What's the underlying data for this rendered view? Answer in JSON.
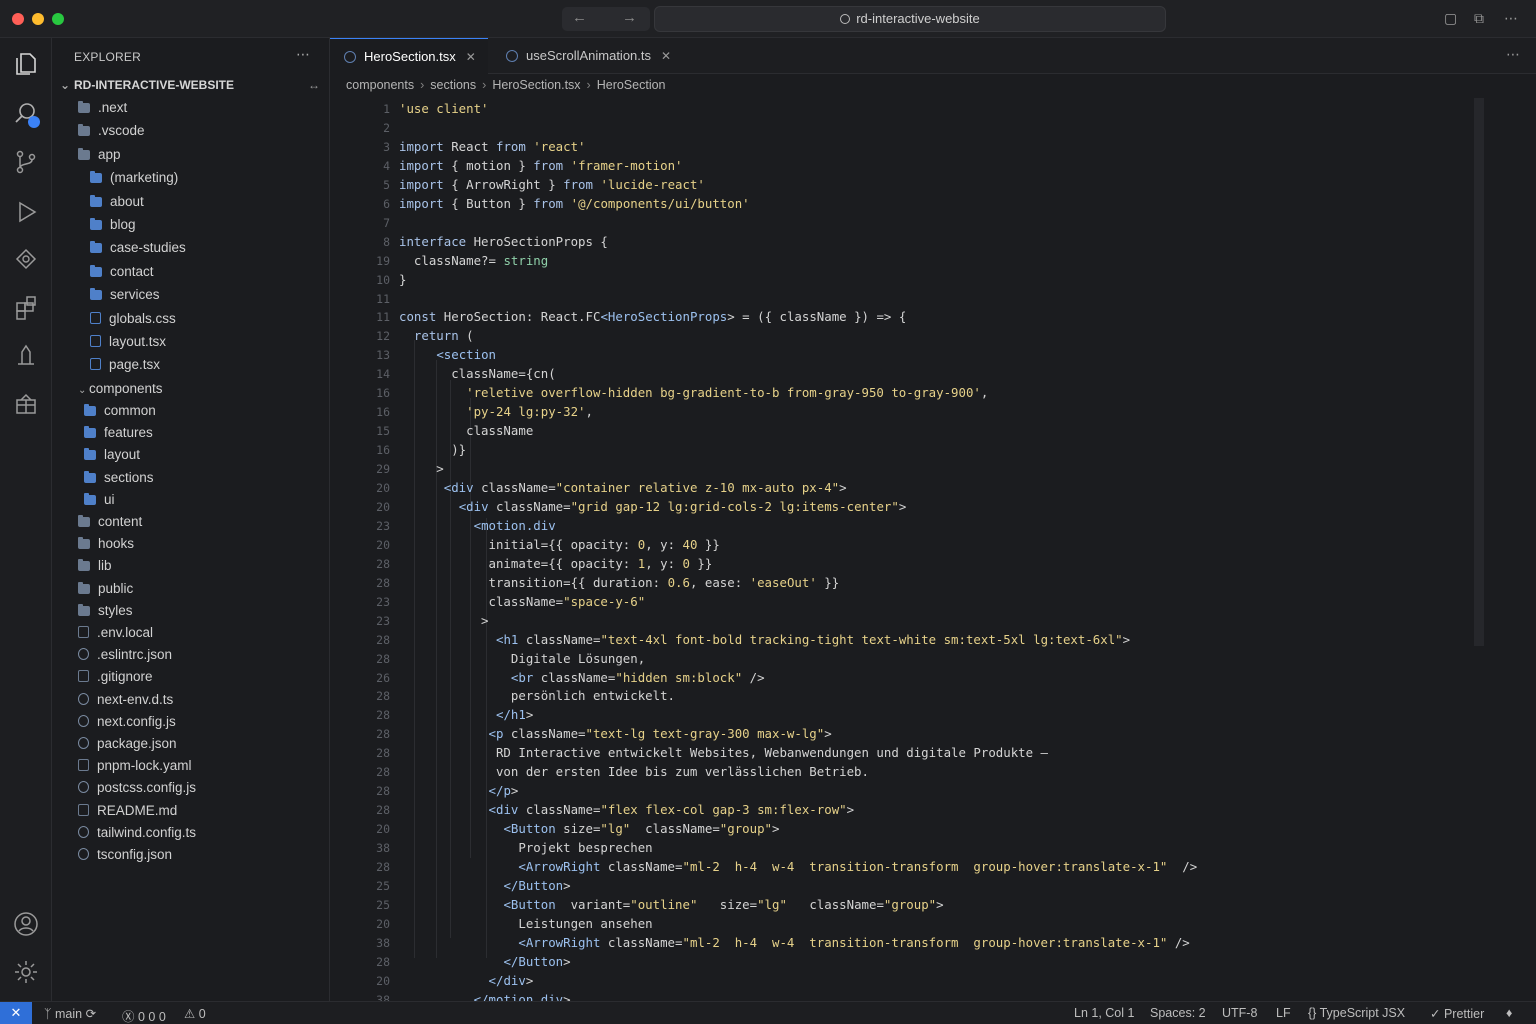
{
  "window": {
    "search_text": "rd-interactive-website"
  },
  "sidebar": {
    "title": "EXPLORER",
    "root": "RD-INTERACTIVE-WEBSITE",
    "items": [
      {
        "label": ".next",
        "type": "folder",
        "depth": 0
      },
      {
        "label": ".vscode",
        "type": "folder",
        "depth": 0
      },
      {
        "label": "app",
        "type": "folder",
        "depth": 0
      },
      {
        "label": "(marketing)",
        "type": "folder",
        "depth": 1
      },
      {
        "label": "about",
        "type": "folder",
        "depth": 1
      },
      {
        "label": "blog",
        "type": "folder",
        "depth": 1
      },
      {
        "label": "case-studies",
        "type": "folder",
        "depth": 1
      },
      {
        "label": "contact",
        "type": "folder",
        "depth": 1
      },
      {
        "label": "services",
        "type": "folder",
        "depth": 1
      },
      {
        "label": "globals.css",
        "type": "file",
        "depth": 1
      },
      {
        "label": "layout.tsx",
        "type": "file",
        "depth": 1
      },
      {
        "label": "page.tsx",
        "type": "file",
        "depth": 1
      },
      {
        "label": "components",
        "type": "folder-open",
        "depth": 0
      },
      {
        "label": "common",
        "type": "folder",
        "depth": 1
      },
      {
        "label": "features",
        "type": "folder",
        "depth": 1
      },
      {
        "label": "layout",
        "type": "folder",
        "depth": 1
      },
      {
        "label": "sections",
        "type": "folder",
        "depth": 1
      },
      {
        "label": "ui",
        "type": "folder",
        "depth": 1
      },
      {
        "label": "content",
        "type": "folder",
        "depth": 0
      },
      {
        "label": "hooks",
        "type": "folder",
        "depth": 0
      },
      {
        "label": "lib",
        "type": "folder",
        "depth": 0
      },
      {
        "label": "public",
        "type": "folder",
        "depth": 0
      },
      {
        "label": "styles",
        "type": "folder",
        "depth": 0
      },
      {
        "label": ".env.local",
        "type": "file",
        "depth": 0
      },
      {
        "label": ".eslintrc.json",
        "type": "file",
        "depth": 0
      },
      {
        "label": ".gitignore",
        "type": "file",
        "depth": 0
      },
      {
        "label": "next-env.d.ts",
        "type": "file",
        "depth": 0
      },
      {
        "label": "next.config.js",
        "type": "file",
        "depth": 0
      },
      {
        "label": "package.json",
        "type": "file",
        "depth": 0
      },
      {
        "label": "pnpm-lock.yaml",
        "type": "file",
        "depth": 0
      },
      {
        "label": "postcss.config.js",
        "type": "file",
        "depth": 0
      },
      {
        "label": "README.md",
        "type": "file",
        "depth": 0
      },
      {
        "label": "tailwind.config.ts",
        "type": "file",
        "depth": 0
      },
      {
        "label": "tsconfig.json",
        "type": "file",
        "depth": 0
      }
    ]
  },
  "tabs": [
    {
      "label": "HeroSection.tsx",
      "active": true
    },
    {
      "label": "useScrollAnimation.ts",
      "active": false
    }
  ],
  "breadcrumb": [
    "components",
    "sections",
    "HeroSection.tsx",
    "HeroSection"
  ],
  "editor": {
    "lines": [
      {
        "n": "1",
        "text": "'use client'"
      },
      {
        "n": "2",
        "text": ""
      },
      {
        "n": "3",
        "text": "import React from 'react'"
      },
      {
        "n": "4",
        "text": "import { motion } from 'framer-motion'"
      },
      {
        "n": "5",
        "text": "import { ArrowRight } from 'lucide-react'"
      },
      {
        "n": "6",
        "text": "import { Button } from '@/components/ui/button'"
      },
      {
        "n": "7",
        "text": ""
      },
      {
        "n": "8",
        "text": "interface HeroSectionProps {"
      },
      {
        "n": "19",
        "text": "  className?= string"
      },
      {
        "n": "10",
        "text": "}"
      },
      {
        "n": "11",
        "text": ""
      },
      {
        "n": "11",
        "text": "const HeroSection: React.FC<HeroSectionProps> = ({ className }) => {"
      },
      {
        "n": "12",
        "text": "  return ("
      },
      {
        "n": "13",
        "text": "     <section"
      },
      {
        "n": "14",
        "text": "       className={cn("
      },
      {
        "n": "16",
        "text": "         'reletive overflow-hidden bg-gradient-to-b from-gray-950 to-gray-900',"
      },
      {
        "n": "16",
        "text": "         'py-24 lg:py-32',"
      },
      {
        "n": "15",
        "text": "         className"
      },
      {
        "n": "16",
        "text": "       )}"
      },
      {
        "n": "29",
        "text": "     >"
      },
      {
        "n": "20",
        "text": "      <div className=\"container relative z-10 mx-auto px-4\">"
      },
      {
        "n": "20",
        "text": "        <div className=\"grid gap-12 lg:grid-cols-2 lg:items-center\">"
      },
      {
        "n": "23",
        "text": "          <motion.div"
      },
      {
        "n": "20",
        "text": "            initial={{ opacity: 0, y: 40 }}"
      },
      {
        "n": "28",
        "text": "            animate={{ opacity: 1, y: 0 }}"
      },
      {
        "n": "28",
        "text": "            transition={{ duration: 0.6, ease: 'easeOut' }}"
      },
      {
        "n": "23",
        "text": "            className=\"space-y-6\""
      },
      {
        "n": "23",
        "text": "           >"
      },
      {
        "n": "28",
        "text": "             <h1 className=\"text-4xl font-bold tracking-tight text-white sm:text-5xl lg:text-6xl\">"
      },
      {
        "n": "28",
        "text": "               Digitale Lösungen,"
      },
      {
        "n": "26",
        "text": "               <br className=\"hidden sm:block\" />"
      },
      {
        "n": "28",
        "text": "               persönlich entwickelt."
      },
      {
        "n": "28",
        "text": "             </h1>"
      },
      {
        "n": "28",
        "text": "            <p className=\"text-lg text-gray-300 max-w-lg\">"
      },
      {
        "n": "28",
        "text": "             RD Interactive entwickelt Websites, Webanwendungen und digitale Produkte –"
      },
      {
        "n": "28",
        "text": "             von der ersten Idee bis zum verlässlichen Betrieb."
      },
      {
        "n": "28",
        "text": "            </p>"
      },
      {
        "n": "28",
        "text": "            <div className=\"flex flex-col gap-3 sm:flex-row\">"
      },
      {
        "n": "20",
        "text": "              <Button size=\"lg\"  className=\"group\">"
      },
      {
        "n": "38",
        "text": "                Projekt besprechen"
      },
      {
        "n": "28",
        "text": "                <ArrowRight className=\"ml-2  h-4  w-4  transition-transform  group-hover:translate-x-1\"  />"
      },
      {
        "n": "25",
        "text": "              </Button>"
      },
      {
        "n": "25",
        "text": "              <Button  variant=\"outline\"   size=\"lg\"   className=\"group\">"
      },
      {
        "n": "20",
        "text": "                Leistungen ansehen"
      },
      {
        "n": "38",
        "text": "                <ArrowRight className=\"ml-2  h-4  w-4  transition-transform  group-hover:translate-x-1\" />"
      },
      {
        "n": "28",
        "text": "              </Button>"
      },
      {
        "n": "20",
        "text": "            </div>"
      },
      {
        "n": "38",
        "text": "          </motion.div>"
      }
    ]
  },
  "statusbar": {
    "branch": "main",
    "problems": "0 0 0",
    "warnings": "0",
    "position": "Ln 1, Col 1",
    "spaces": "Spaces: 2",
    "encoding": "UTF-8",
    "eol": "LF",
    "language": "TypeScript JSX",
    "formatter": "Prettier"
  },
  "colors": {
    "accent": "#3b82f6",
    "background": "#1b1c1f",
    "string": "#e6d189",
    "keyword": "#a9c3e8"
  }
}
